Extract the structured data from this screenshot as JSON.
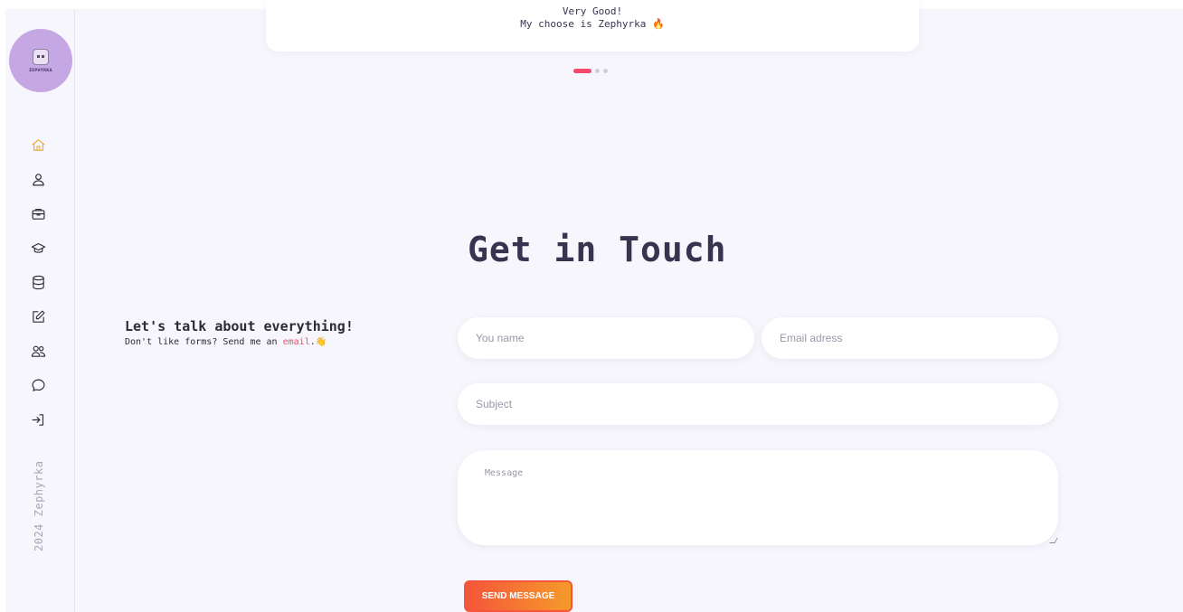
{
  "sidebar": {
    "avatar_text": "ZEPHYRKA",
    "nav_items": [
      {
        "name": "home",
        "icon": "home-icon",
        "active": true
      },
      {
        "name": "about",
        "icon": "user-icon",
        "active": false
      },
      {
        "name": "portfolio",
        "icon": "briefcase-icon",
        "active": false
      },
      {
        "name": "education",
        "icon": "graduation-cap-icon",
        "active": false
      },
      {
        "name": "skills",
        "icon": "database-icon",
        "active": false
      },
      {
        "name": "blog",
        "icon": "edit-icon",
        "active": false
      },
      {
        "name": "team",
        "icon": "users-icon",
        "active": false
      },
      {
        "name": "chat",
        "icon": "chat-icon",
        "active": false
      },
      {
        "name": "login",
        "icon": "sign-in-icon",
        "active": false
      }
    ],
    "copyright": "2024 Zephyrka"
  },
  "testimonial": {
    "line1": "Very Good!",
    "line2": "My choose is Zephyrka",
    "emoji": "🔥",
    "slides_total": 3,
    "active_slide": 1
  },
  "contact": {
    "heading": "Get in Touch",
    "talk_title": "Let's talk about everything!",
    "talk_sub_prefix": "Don't like forms? Send me an",
    "talk_sub_link": "email",
    "talk_sub_suffix": ".",
    "wave_emoji": "👋",
    "name_placeholder": "You name",
    "email_placeholder": "Email adress",
    "subject_placeholder": "Subject",
    "message_placeholder": "Message",
    "send_label": "SEND MESSAGE"
  },
  "colors": {
    "accent_active": "#f0a830",
    "dot_active": "#f54a6a",
    "link": "#f54a6a",
    "button_gradient_start": "#f5553a",
    "button_gradient_end": "#f59a2a",
    "avatar_bg": "#c5a7e3"
  }
}
